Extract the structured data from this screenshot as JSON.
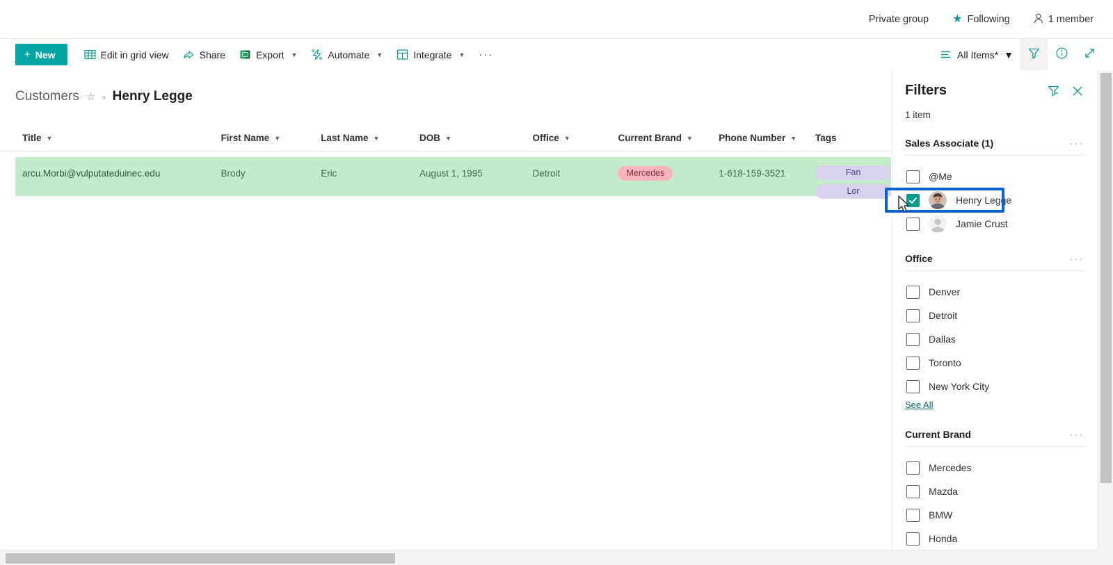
{
  "topbar": {
    "privacy_label": "Private group",
    "following_label": "Following",
    "members_label": "1 member",
    "star_icon": "star-icon",
    "person_icon": "person-icon"
  },
  "commandbar": {
    "new_label": "New",
    "items": [
      {
        "label": "Edit in grid view",
        "icon": "grid-icon",
        "has_chevron": false
      },
      {
        "label": "Share",
        "icon": "share-icon",
        "has_chevron": false
      },
      {
        "label": "Export",
        "icon": "excel-icon",
        "has_chevron": true
      },
      {
        "label": "Automate",
        "icon": "automate-icon",
        "has_chevron": true
      },
      {
        "label": "Integrate",
        "icon": "integrate-icon",
        "has_chevron": true
      }
    ],
    "overflow_label": "···",
    "view_label": "All Items*",
    "view_icon": "list-view-icon",
    "filter_icon": "filter-icon",
    "info_icon": "info-icon",
    "expand_icon": "expand-icon",
    "accent_color": "#03a5a5"
  },
  "breadcrumb": {
    "root": "Customers",
    "star_icon": "star-outline-icon",
    "separator": "›",
    "current": "Henry Legge"
  },
  "table": {
    "columns": [
      {
        "label": "Title",
        "key": "title"
      },
      {
        "label": "First Name",
        "key": "first"
      },
      {
        "label": "Last Name",
        "key": "last"
      },
      {
        "label": "DOB",
        "key": "dob"
      },
      {
        "label": "Office",
        "key": "office"
      },
      {
        "label": "Current Brand",
        "key": "brand"
      },
      {
        "label": "Phone Number",
        "key": "phone"
      },
      {
        "label": "Tags",
        "key": "tags"
      }
    ],
    "rows": [
      {
        "title": "arcu.Morbi@vulputateduinec.edu",
        "first": "Brody",
        "last": "Eric",
        "dob": "August 1, 1995",
        "office": "Detroit",
        "brand": "Mercedes",
        "phone": "1-618-159-3521",
        "tags": [
          "Fan",
          "Lor"
        ],
        "selected": true,
        "row_color": "#c3ecca",
        "brand_pill_color": "#ffb3bf",
        "tag_pill_color": "#d9d2ee"
      }
    ]
  },
  "filters_panel": {
    "title": "Filters",
    "clear_icon": "clear-filter-icon",
    "close_icon": "close-icon",
    "item_count": "1 item",
    "more_glyph": "···",
    "groups": [
      {
        "title": "Sales Associate (1)",
        "options": [
          {
            "label": "@Me",
            "checked": false,
            "avatar": "none"
          },
          {
            "label": "Henry Legge",
            "checked": true,
            "avatar": "photo",
            "highlighted": true
          },
          {
            "label": "Jamie Crust",
            "checked": false,
            "avatar": "placeholder"
          }
        ],
        "see_all": null
      },
      {
        "title": "Office",
        "options": [
          {
            "label": "Denver",
            "checked": false,
            "avatar": "none"
          },
          {
            "label": "Detroit",
            "checked": false,
            "avatar": "none"
          },
          {
            "label": "Dallas",
            "checked": false,
            "avatar": "none"
          },
          {
            "label": "Toronto",
            "checked": false,
            "avatar": "none"
          },
          {
            "label": "New York City",
            "checked": false,
            "avatar": "none"
          }
        ],
        "see_all": "See All"
      },
      {
        "title": "Current Brand",
        "options": [
          {
            "label": "Mercedes",
            "checked": false,
            "avatar": "none"
          },
          {
            "label": "Mazda",
            "checked": false,
            "avatar": "none"
          },
          {
            "label": "BMW",
            "checked": false,
            "avatar": "none"
          },
          {
            "label": "Honda",
            "checked": false,
            "avatar": "none"
          }
        ],
        "see_all": null
      }
    ],
    "checked_color": "#0b9b8a",
    "highlight_color": "#0a5fd4"
  }
}
